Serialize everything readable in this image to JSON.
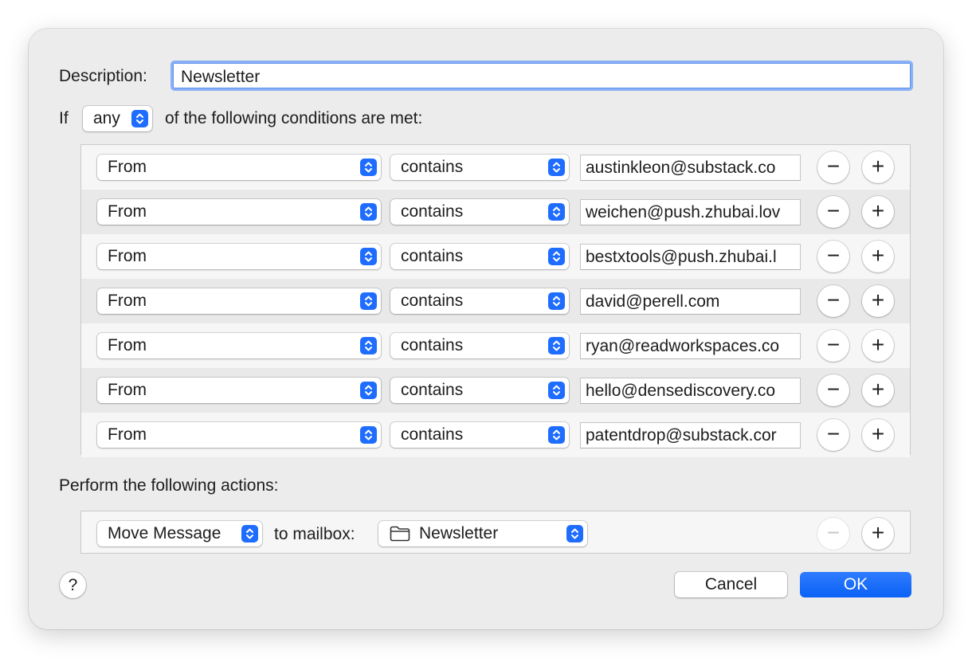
{
  "description": {
    "label": "Description:",
    "value": "Newsletter"
  },
  "condition_header": {
    "prefix": "If",
    "match": "any",
    "suffix": "of the following conditions are met:"
  },
  "conditions": [
    {
      "field": "From",
      "operator": "contains",
      "value": "austinkleon@substack.co"
    },
    {
      "field": "From",
      "operator": "contains",
      "value": "weichen@push.zhubai.lov"
    },
    {
      "field": "From",
      "operator": "contains",
      "value": "bestxtools@push.zhubai.l"
    },
    {
      "field": "From",
      "operator": "contains",
      "value": "david@perell.com"
    },
    {
      "field": "From",
      "operator": "contains",
      "value": "ryan@readworkspaces.co"
    },
    {
      "field": "From",
      "operator": "contains",
      "value": "hello@densediscovery.co"
    },
    {
      "field": "From",
      "operator": "contains",
      "value": "patentdrop@substack.cor"
    }
  ],
  "actions_label": "Perform the following actions:",
  "action": {
    "type": "Move Message",
    "to_label": "to mailbox:",
    "mailbox": "Newsletter",
    "mailbox_icon": "folder-icon"
  },
  "controls": {
    "remove_symbol": "−",
    "add_symbol": "+"
  },
  "help_label": "?",
  "buttons": {
    "cancel": "Cancel",
    "ok": "OK"
  },
  "colors": {
    "accent": "#1f6dff",
    "focus_ring": "#8ab0f5",
    "sheet_bg": "#ececec"
  }
}
